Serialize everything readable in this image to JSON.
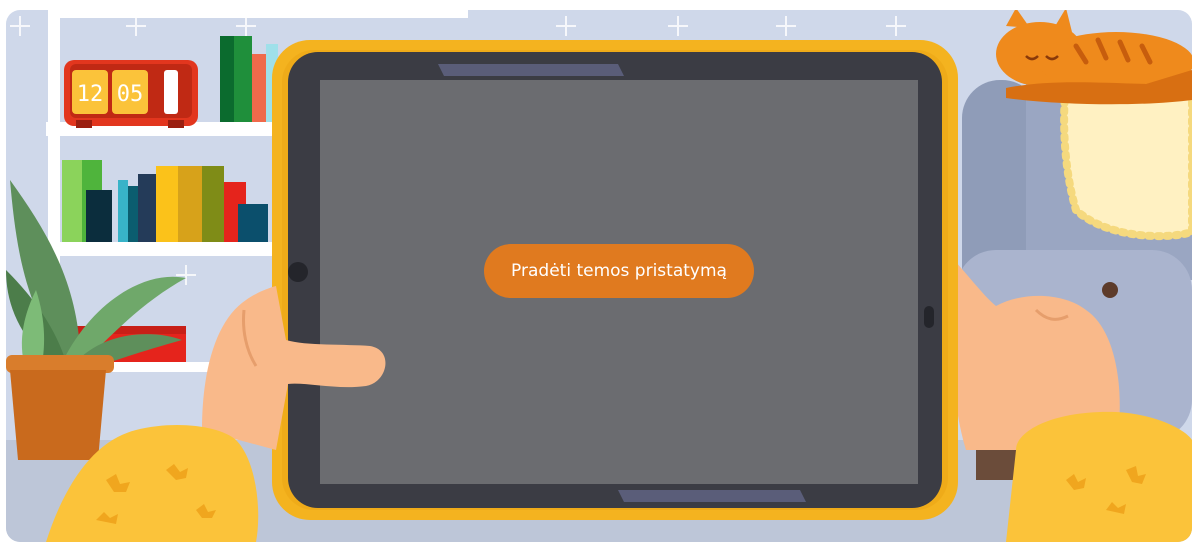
{
  "clock": {
    "hours": "12",
    "minutes": "05"
  },
  "start_button": {
    "label": "Pradėti temos pristatymą"
  },
  "colors": {
    "wall": "#cfd8ea",
    "floor": "#bdc6d8",
    "tablet_frame": "#f4b31f",
    "tablet_bezel": "#3b3c44",
    "screen": "#6b6c70",
    "button": "#e07a1f",
    "skin": "#f9b98a",
    "sleeve": "#fbc33a",
    "cat": "#ef8a1c"
  }
}
